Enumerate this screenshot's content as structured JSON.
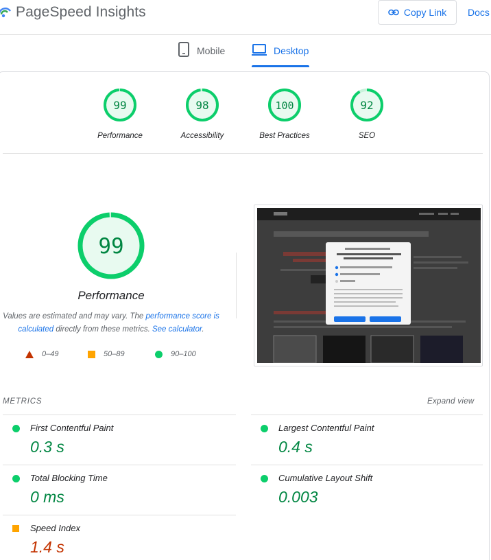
{
  "header": {
    "title": "PageSpeed Insights",
    "copy_link": "Copy Link",
    "docs": "Docs"
  },
  "tabs": [
    {
      "label": "Mobile",
      "icon": "phone-icon",
      "active": false
    },
    {
      "label": "Desktop",
      "icon": "laptop-icon",
      "active": true
    }
  ],
  "scores": [
    {
      "value": "99",
      "label": "Performance",
      "fraction": 0.99
    },
    {
      "value": "98",
      "label": "Accessibility",
      "fraction": 0.98
    },
    {
      "value": "100",
      "label": "Best Practices",
      "fraction": 1.0
    },
    {
      "value": "92",
      "label": "SEO",
      "fraction": 0.92
    }
  ],
  "performance": {
    "score": "99",
    "fraction": 0.99,
    "title": "Performance",
    "note_prefix": "Values are estimated and may vary. The ",
    "note_link1": "performance score is calculated",
    "note_mid": " directly from these metrics. ",
    "note_link2": "See calculator",
    "note_suffix": "."
  },
  "legend": {
    "fail": "0–49",
    "average": "50–89",
    "pass": "90–100"
  },
  "metrics": {
    "header": "METRICS",
    "expand": "Expand view",
    "items": [
      {
        "name": "First Contentful Paint",
        "value": "0.3 s",
        "status": "pass"
      },
      {
        "name": "Largest Contentful Paint",
        "value": "0.4 s",
        "status": "pass"
      },
      {
        "name": "Total Blocking Time",
        "value": "0 ms",
        "status": "pass"
      },
      {
        "name": "Cumulative Layout Shift",
        "value": "0.003",
        "status": "pass"
      },
      {
        "name": "Speed Index",
        "value": "1.4 s",
        "status": "average"
      }
    ]
  },
  "colors": {
    "pass": "#0cce6b",
    "pass_text": "#018642",
    "average": "#ffa400",
    "fail": "#c33300",
    "accent": "#1a73e8"
  }
}
